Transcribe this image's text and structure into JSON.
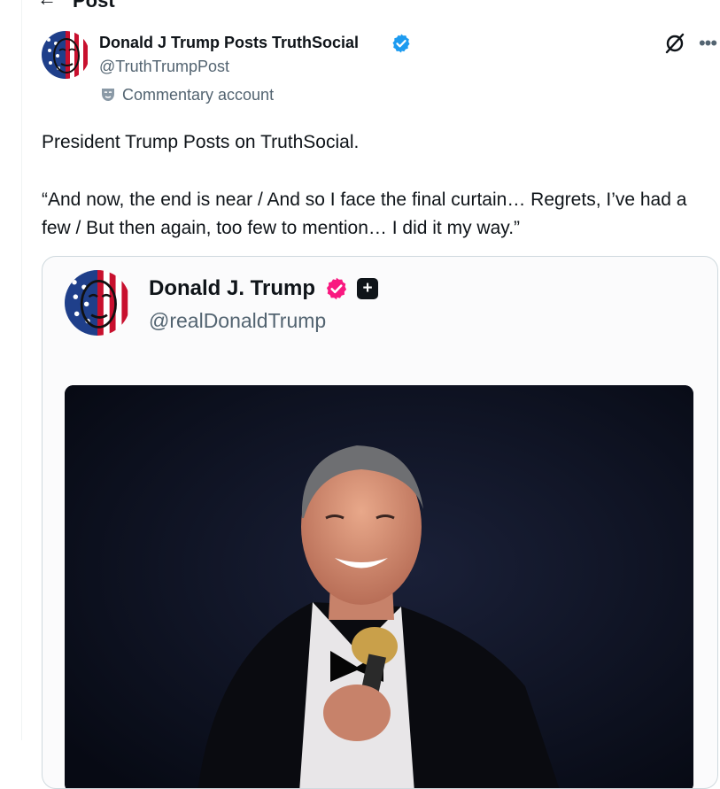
{
  "header": {
    "title": "Post",
    "back_icon": "arrow-left-icon"
  },
  "post": {
    "author_name": "Donald J Trump Posts TruthSocial",
    "author_handle": "@TruthTrumpPost",
    "account_label": "Commentary account",
    "verified_color": "#1d9bf0",
    "text_line1": "President Trump Posts on TruthSocial.",
    "text_line2": "“And now, the end is near / And so I face the final curtain…  Regrets, I’ve had a few / But then again, too few to mention…  I did it my way.”"
  },
  "quoted": {
    "author_name": "Donald J. Trump",
    "author_handle": "@realDonaldTrump",
    "verified_color": "#f91880",
    "plus_badge": "+",
    "media": "video-thumbnail"
  },
  "icons": [
    "arrow-left-icon",
    "verified-badge-icon",
    "grok-icon",
    "more-icon",
    "mask-icon",
    "pink-verified-icon",
    "plus-badge-icon"
  ]
}
